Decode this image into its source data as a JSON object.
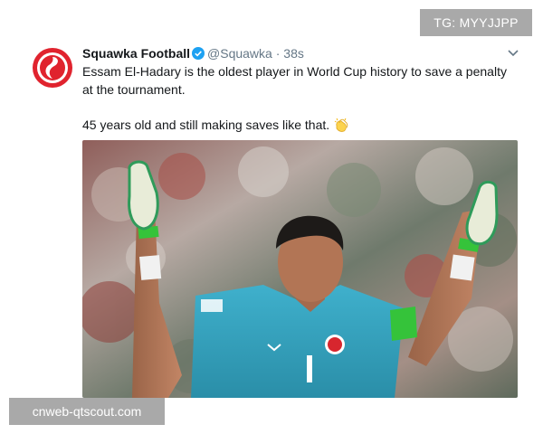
{
  "tweet": {
    "display_name": "Squawka Football",
    "handle": "@Squawka",
    "separator": "·",
    "time": "38s",
    "line1": "Essam El-Hadary is the oldest player in World Cup history to save a penalty at the tournament.",
    "line2": "45 years old and still making saves like that.",
    "emoji": "clapping-hands",
    "player_jersey_number": "1",
    "colors": {
      "brand_red": "#e0232e",
      "verified_blue": "#1da1f2",
      "jersey": "#3aa8c4",
      "armband": "#35c33a",
      "gloves": "#e8ecd8"
    }
  },
  "watermarks": {
    "top_right": "TG: MYYJJPP",
    "bottom_left": "cnweb-qtscout.com"
  }
}
